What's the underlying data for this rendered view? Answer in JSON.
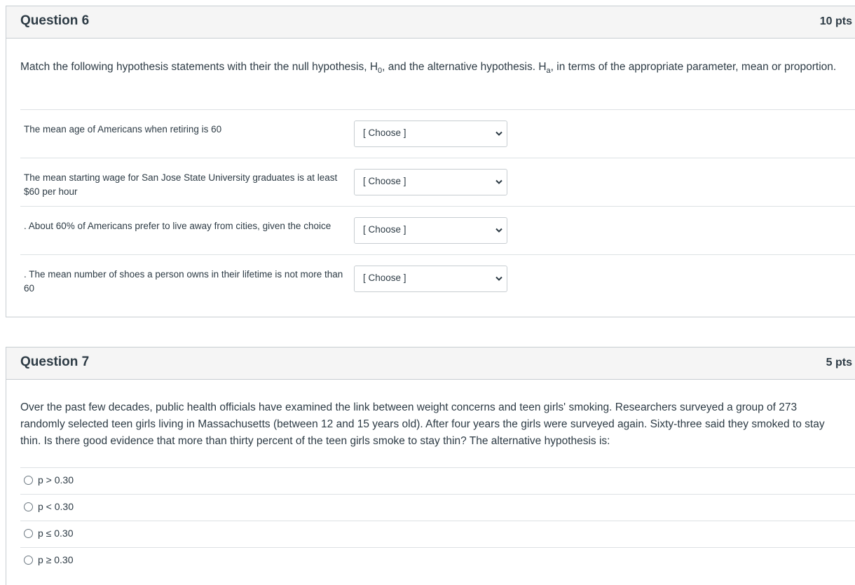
{
  "q6": {
    "title": "Question 6",
    "points": "10 pts",
    "text_pre": "Match the following hypothesis statements with their the null hypothesis, H",
    "text_sub1": "0",
    "text_mid": ", and the alternative hypothesis. H",
    "text_sub2": "a",
    "text_post": ", in terms of the appropriate parameter, mean or proportion.",
    "rows": [
      {
        "label": "The mean age of Americans when retiring is 60",
        "select": "[ Choose ]"
      },
      {
        "label": "The mean starting wage for San Jose State University graduates is at least $60 per hour",
        "select": "[ Choose ]"
      },
      {
        "label": ". About 60% of Americans prefer to live away from cities, given the choice",
        "select": "[ Choose ]"
      },
      {
        "label": ". The mean number of shoes a person owns in their lifetime is not more than 60",
        "select": "[ Choose ]"
      }
    ]
  },
  "q7": {
    "title": "Question 7",
    "points": "5 pts",
    "text": "Over the past few decades, public health officials have examined the link between weight concerns and teen girls' smoking. Researchers surveyed a group of 273 randomly selected teen girls living in Massachusetts (between 12 and 15 years old). After four years the girls were surveyed again. Sixty-three said they smoked to stay thin. Is there good evidence that more than thirty percent of the teen girls smoke to stay thin? The alternative hypothesis is:",
    "options": [
      {
        "label": "p > 0.30"
      },
      {
        "label": "p < 0.30"
      },
      {
        "label": "p ≤ 0.30"
      },
      {
        "label": "p ≥ 0.30"
      }
    ]
  },
  "icons": {
    "select_chevron": "chevron-down-icon",
    "radio": "radio-button-icon"
  },
  "colors": {
    "header_bg": "#f5f5f5",
    "border": "#c7cdd1",
    "text": "#2d3b45"
  }
}
